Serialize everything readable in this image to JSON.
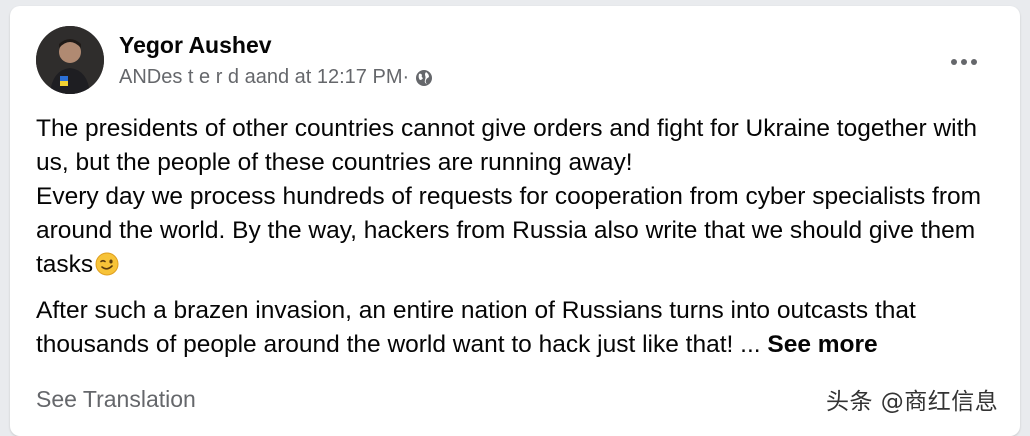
{
  "post": {
    "author": "Yegor Aushev",
    "meta": "ANDes t e r d aand at 12:17 PM·",
    "privacy_icon": "globe-icon",
    "menu_icon": "more-horizontal-icon",
    "paragraphs": [
      "The presidents of other countries cannot give orders and fight for Ukraine together with us, but the people of these countries are running away!",
      "Every day we process hundreds of requests for cooperation from cyber specialists from around the world. By the way, hackers from Russia also write that we should give them tasks",
      "After such a brazen invasion, an entire nation of Russians turns into outcasts that thousands of people around the world want to hack just like that! ... "
    ],
    "emoji_icon": "winking-face-icon",
    "see_more": "See more",
    "see_translation": "See Translation"
  },
  "watermark": "头条 @商红信息"
}
